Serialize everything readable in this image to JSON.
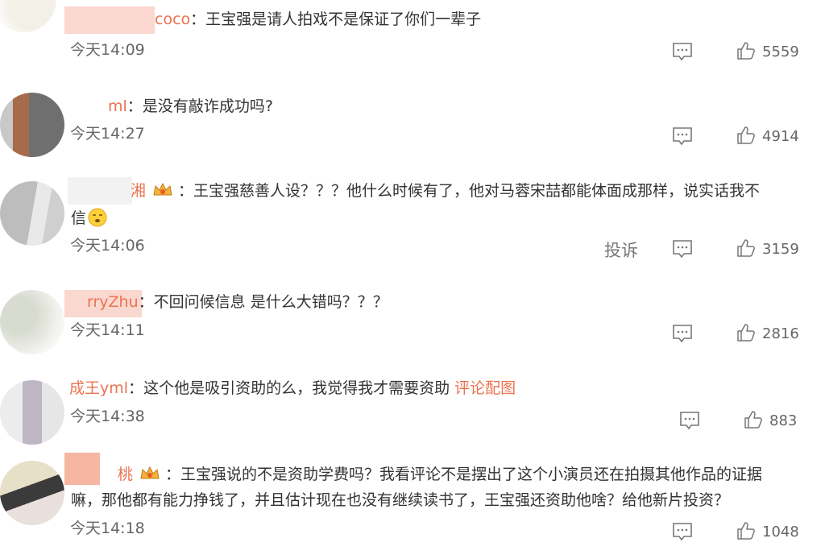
{
  "comments": [
    {
      "name": "coco",
      "text": "王宝强是请人拍戏不是保证了你们一辈子",
      "time": "今天14:09",
      "likes": "5559"
    },
    {
      "name": "ml",
      "text": "是没有敲诈成功吗?",
      "time": "今天14:27",
      "likes": "4914"
    },
    {
      "name": "湘",
      "text": "王宝强慈善人设？？？他什么时候有了，他对马蓉宋喆都能体面成那样，说实话我不",
      "text2": "信",
      "time": "今天14:06",
      "report": "投诉",
      "likes": "3159"
    },
    {
      "name": "rryZhu",
      "text": "不回问候信息 是什么大错吗？？？",
      "time": "今天14:11",
      "likes": "2816"
    },
    {
      "name": "成王yml",
      "text": "这个他是吸引资助的么，我觉得我才需要资助",
      "link": "评论配图",
      "time": "今天14:38",
      "likes": "883"
    },
    {
      "name": "桃",
      "text": "王宝强说的不是资助学费吗？我看评论不是摆出了这个小演员还在拍摄其他作品的证据",
      "text2": "嘛，那他都有能力挣钱了，并且估计现在也没有继续读书了，王宝强还资助他啥？给他新片投资？",
      "time": "今天14:18",
      "likes": "1048"
    }
  ],
  "colors": {
    "name": "#eb7350",
    "text": "#333333",
    "meta": "#666666"
  },
  "icons": [
    "comment-icon",
    "thumbs-up-icon",
    "crown-badge-icon",
    "emoji-icon"
  ]
}
